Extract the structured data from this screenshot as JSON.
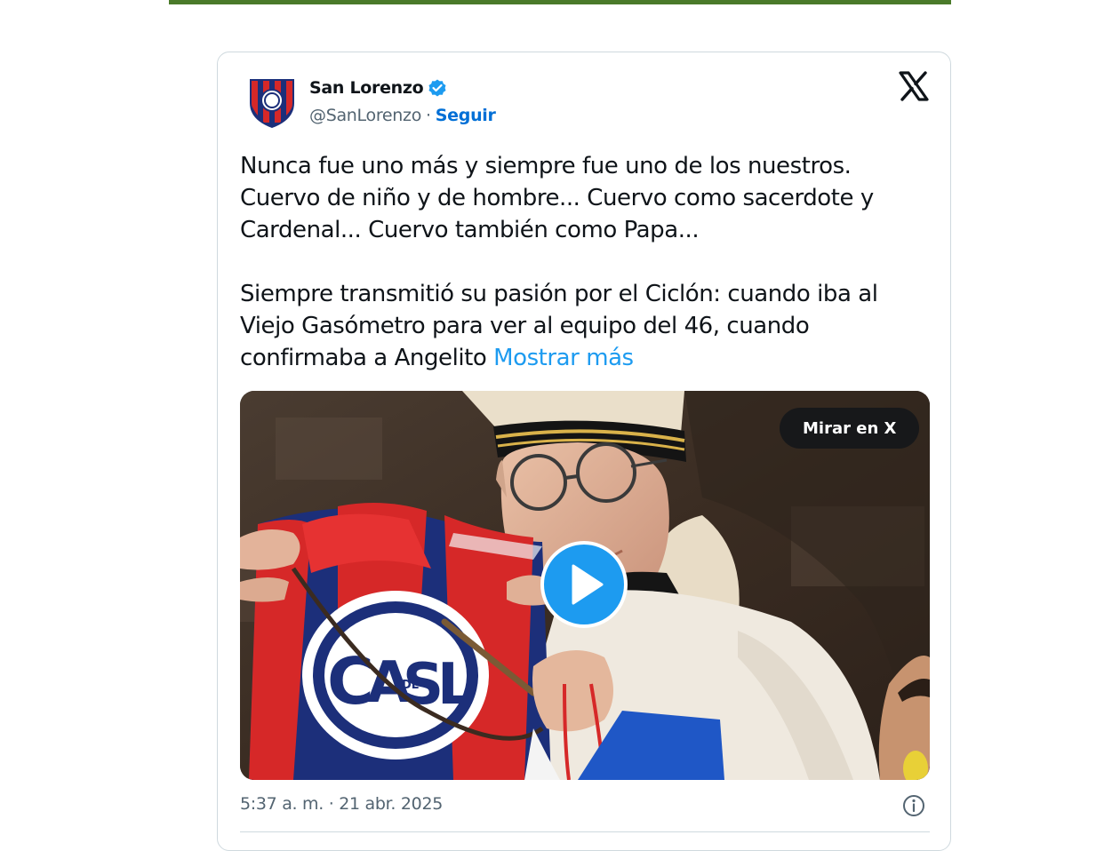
{
  "tweet": {
    "author": {
      "display_name": "San Lorenzo",
      "handle": "@SanLorenzo",
      "separator": "·",
      "follow_label": "Seguir",
      "verified": true
    },
    "text_paragraphs": [
      "Nunca fue uno más y siempre fue uno de los nuestros. Cuervo de niño y de hombre... Cuervo como sacerdote y Cardenal... Cuervo también como Papa...",
      "Siempre transmitió su pasión por el Ciclón: cuando iba al Viejo Gasómetro para ver al equipo del 46, cuando confirmaba a Angelito"
    ],
    "show_more_label": "Mostrar más",
    "media": {
      "watch_label": "Mirar en X",
      "pennant_letters": [
        "C",
        "A",
        "S",
        "L",
        "DE"
      ]
    },
    "timestamp": "5:37 a. m. · 21 abr. 2025"
  },
  "icons": {
    "avatar": "san-lorenzo-crest",
    "verified": "verified-badge-icon",
    "brand": "x-logo-icon",
    "play": "play-icon",
    "info": "info-icon"
  },
  "colors": {
    "accent_blue": "#1d9bf0",
    "link_blue": "#006fd6",
    "top_bar_green": "#4a7a2a",
    "text_primary": "#0f1419",
    "text_secondary": "#536471",
    "club_red": "#d62828",
    "club_navy": "#1c2f7a"
  }
}
